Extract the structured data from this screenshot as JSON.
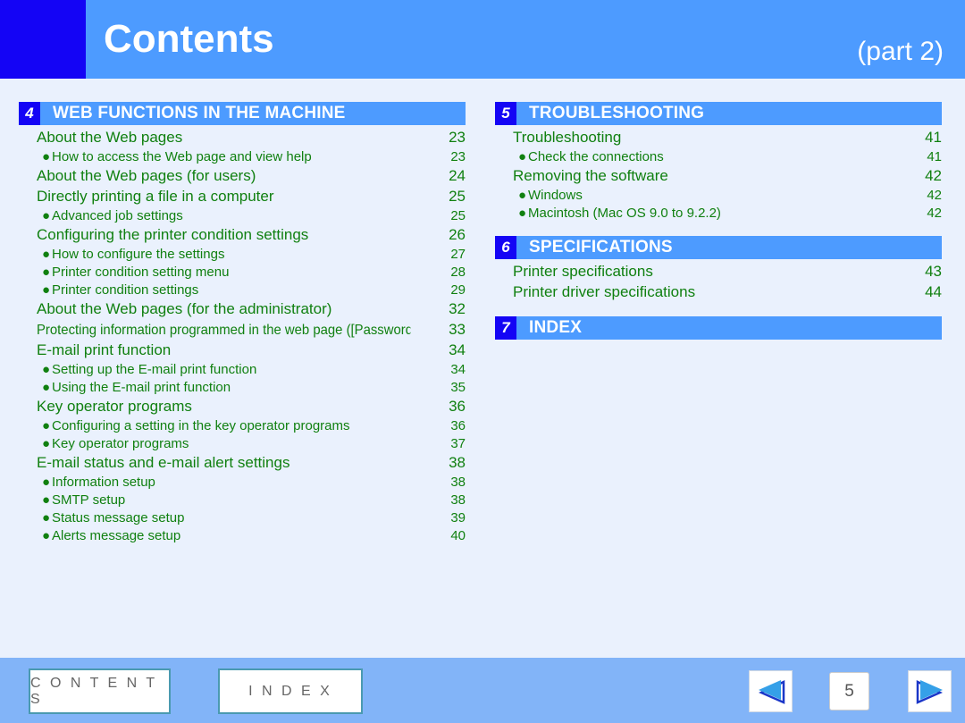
{
  "header": {
    "title": "Contents",
    "part_label": "(part 2)",
    "bar_color": "#4d9bff",
    "corner_color": "#1404f5"
  },
  "colors": {
    "page_background": "#eaf1fd",
    "toc_text": "#108010",
    "section_bar": "#4d9bff",
    "section_number_badge": "#1404f5",
    "footer": "#82b4f8",
    "arrow_fill": "#35a0e8",
    "arrow_outline": "#1a36c8"
  },
  "columns": {
    "left": [
      {
        "number": "4",
        "title": "WEB FUNCTIONS IN THE MACHINE",
        "entries": [
          {
            "level": 1,
            "label": "About the Web pages",
            "page": "23"
          },
          {
            "level": 2,
            "label": "How to access the Web page and view help",
            "page": "23"
          },
          {
            "level": 1,
            "label": "About the Web pages (for users)",
            "page": "24"
          },
          {
            "level": 1,
            "label": "Directly printing a file in a computer",
            "page": "25"
          },
          {
            "level": 2,
            "label": "Advanced job settings",
            "page": "25"
          },
          {
            "level": 1,
            "label": "Configuring the printer condition settings",
            "page": "26"
          },
          {
            "level": 2,
            "label": "How to configure the settings",
            "page": "27"
          },
          {
            "level": 2,
            "label": "Printer condition setting menu",
            "page": "28"
          },
          {
            "level": 2,
            "label": "Printer condition settings",
            "page": "29"
          },
          {
            "level": 1,
            "label": "About the Web pages (for the administrator)",
            "page": "32"
          },
          {
            "level": 1,
            "condensed": true,
            "label": "Protecting information programmed in the web page ([Passwords])",
            "page": "33"
          },
          {
            "level": 1,
            "label": "E-mail print function",
            "page": "34"
          },
          {
            "level": 2,
            "label": "Setting up the E-mail print function",
            "page": "34"
          },
          {
            "level": 2,
            "label": "Using the E-mail print function",
            "page": "35"
          },
          {
            "level": 1,
            "label": "Key operator programs",
            "page": "36"
          },
          {
            "level": 2,
            "label": "Configuring a setting in the key operator programs",
            "page": "36"
          },
          {
            "level": 2,
            "label": "Key operator programs",
            "page": "37"
          },
          {
            "level": 1,
            "label": "E-mail status and e-mail alert settings",
            "page": "38"
          },
          {
            "level": 2,
            "label": "Information setup",
            "page": "38"
          },
          {
            "level": 2,
            "label": "SMTP setup",
            "page": "38"
          },
          {
            "level": 2,
            "label": "Status message setup",
            "page": "39"
          },
          {
            "level": 2,
            "label": "Alerts message setup",
            "page": "40"
          }
        ]
      }
    ],
    "right": [
      {
        "number": "5",
        "title": "TROUBLESHOOTING",
        "entries": [
          {
            "level": 1,
            "label": "Troubleshooting",
            "page": "41"
          },
          {
            "level": 2,
            "label": "Check the connections",
            "page": "41"
          },
          {
            "level": 1,
            "label": "Removing the software",
            "page": "42"
          },
          {
            "level": 2,
            "label": "Windows",
            "page": "42"
          },
          {
            "level": 2,
            "label": "Macintosh (Mac OS 9.0 to 9.2.2)",
            "page": "42"
          }
        ]
      },
      {
        "number": "6",
        "title": "SPECIFICATIONS",
        "entries": [
          {
            "level": 1,
            "label": "Printer specifications",
            "page": "43"
          },
          {
            "level": 1,
            "label": "Printer driver specifications",
            "page": "44"
          }
        ]
      },
      {
        "number": "7",
        "title": "INDEX",
        "entries": []
      }
    ]
  },
  "footer": {
    "contents_button": "C O N T E N T S",
    "index_button": "I N D E X",
    "page_number": "5",
    "prev_icon": "left-triangle-icon",
    "next_icon": "right-triangle-icon"
  }
}
